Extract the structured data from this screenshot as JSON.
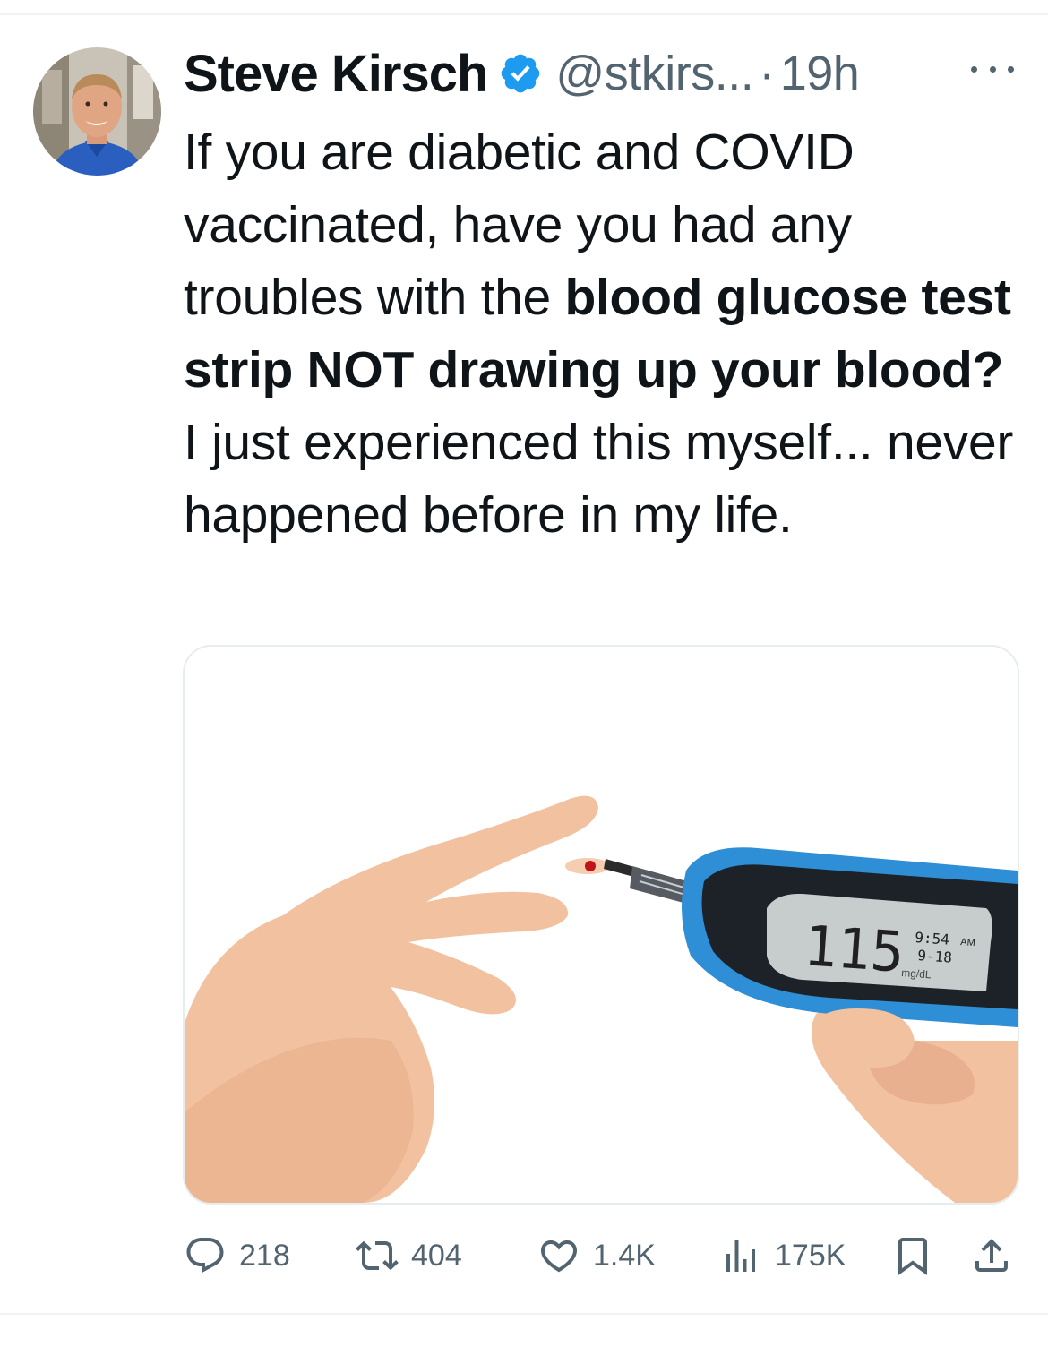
{
  "tweet": {
    "author_name": "Steve Kirsch",
    "handle": "@stkirs...",
    "separator": "·",
    "time": "19h",
    "text_parts": [
      {
        "text": "If you are diabetic and COVID vaccinated, have you had any troubles with the ",
        "bold": false
      },
      {
        "text": "blood glucose test strip NOT drawing up your blood?",
        "bold": true
      },
      {
        "text": " I just experienced this myself... never happened before in my life.",
        "bold": false
      }
    ],
    "media": {
      "meter_reading": "115",
      "meter_time": "9:54",
      "meter_ampm": "AM",
      "meter_date": "9-18",
      "meter_unit": "mg/dL"
    }
  },
  "actions": {
    "replies": "218",
    "retweets": "404",
    "likes": "1.4K",
    "views": "175K"
  },
  "icons": {
    "verified": "verified-badge-icon",
    "more": "more-dots-icon",
    "reply": "reply-icon",
    "retweet": "retweet-icon",
    "like": "heart-icon",
    "views": "views-chart-icon",
    "bookmark": "bookmark-icon",
    "share": "share-icon"
  },
  "colors": {
    "verified": "#1d9bf0",
    "text": "#0f1419",
    "secondary": "#536471",
    "meter_blue": "#2e8fd6"
  }
}
